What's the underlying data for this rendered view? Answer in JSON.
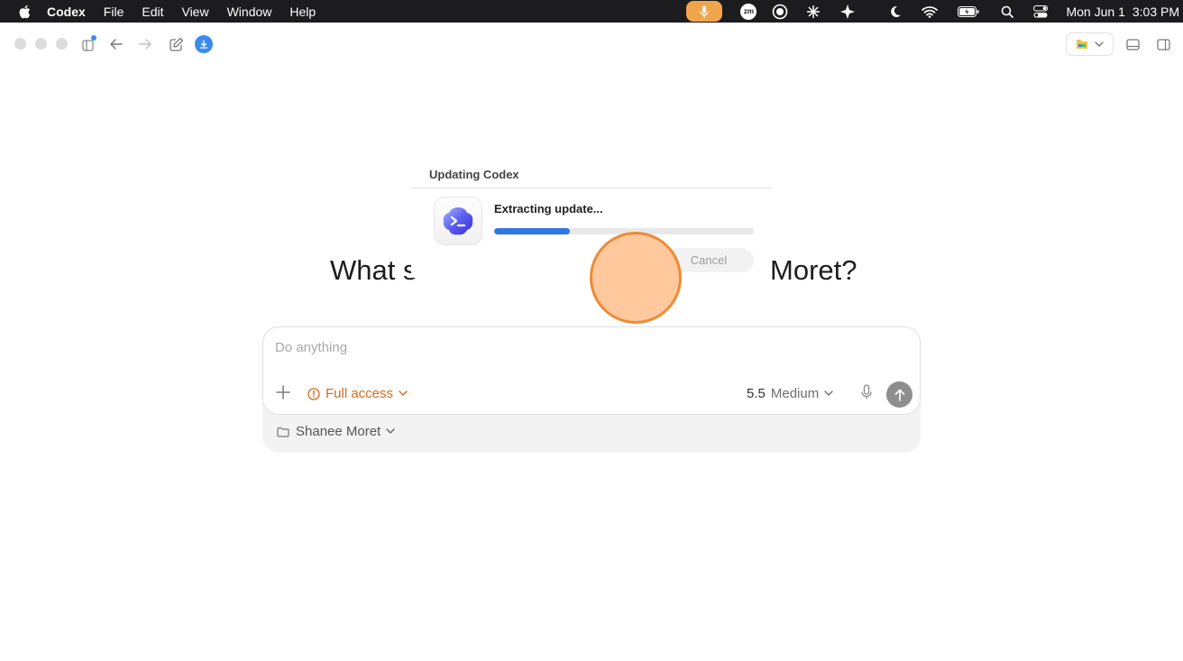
{
  "menubar": {
    "app_name": "Codex",
    "menus": [
      "File",
      "Edit",
      "View",
      "Window",
      "Help"
    ],
    "date": "Mon Jun 1",
    "time": "3:03 PM",
    "zoom_badge": "zm",
    "status_icons": [
      "microphone-icon",
      "zoom-icon",
      "record-icon",
      "asterisk-icon",
      "sparkle-icon",
      "moon-icon",
      "wifi-icon",
      "battery-icon",
      "search-icon",
      "control-center-icon"
    ]
  },
  "colors": {
    "accent_blue": "#2e78e4",
    "access_orange": "#d46b1f",
    "click_indicator": "#ee8a35"
  },
  "heading": {
    "left_visible": "What s",
    "right_visible": "Moret?"
  },
  "composer": {
    "placeholder": "Do anything",
    "access_label": "Full access",
    "model_version": "5.5",
    "effort": "Medium",
    "workspace": "Shanee Moret"
  },
  "dialog": {
    "title": "Updating Codex",
    "status": "Extracting update...",
    "progress": 0.29,
    "cancel_label": "Cancel"
  }
}
